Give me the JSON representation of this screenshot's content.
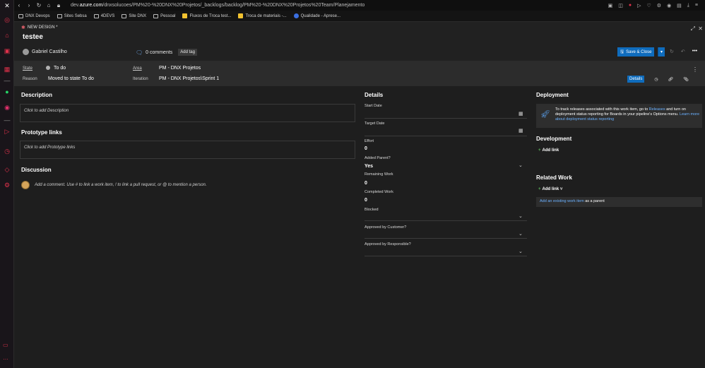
{
  "browser": {
    "url_prefix": "dev.",
    "url_domain": "azure.com",
    "url_path": "/dnxsolucoes/PM%20-%20DNX%20Projetos/_backlogs/backlog/PM%20-%20DNX%20Projetos%20Team/Planejamento",
    "bookmarks": [
      {
        "label": "DNX Devops",
        "icon": "folder-icon"
      },
      {
        "label": "Sites Sebsa",
        "icon": "folder-icon"
      },
      {
        "label": "4DEVS",
        "icon": "folder-icon"
      },
      {
        "label": "Site DNX",
        "icon": "folder-icon"
      },
      {
        "label": "Pessoal",
        "icon": "folder-icon"
      },
      {
        "label": "Fluxos de Troca test...",
        "icon": "bookmark-icon"
      },
      {
        "label": "Troca de materiais -...",
        "icon": "bookmark-icon"
      },
      {
        "label": "Qualidade - Aprese...",
        "icon": "bookmark-icon"
      }
    ]
  },
  "workitem": {
    "type_label": "NEW DESIGN *",
    "title": "testee",
    "assigned_to": "Gabriel Castilho",
    "comments": "0 comments",
    "add_tag": "Add tag",
    "save_label": "Save & Close"
  },
  "statebar": {
    "state_label": "State",
    "state_value": "To do",
    "reason_label": "Reason",
    "reason_value": "Moved to state To do",
    "area_label": "Area",
    "area_value": "PM - DNX Projetos",
    "iteration_label": "Iteration",
    "iteration_value": "PM - DNX Projetos\\Sprint 1",
    "details_tab": "Details"
  },
  "left": {
    "description_title": "Description",
    "description_placeholder": "Click to add Description",
    "prototype_title": "Prototype links",
    "prototype_placeholder": "Click to add Prototype links",
    "discussion_title": "Discussion",
    "discussion_placeholder": "Add a comment. Use # to link a work item, ! to link a pull request, or @ to mention a person."
  },
  "details": {
    "title": "Details",
    "start_date": "Start Date",
    "target_date": "Target Date",
    "effort_label": "Effort",
    "effort_value": "0",
    "added_parent_label": "Added Parent?",
    "added_parent_value": "Yes",
    "remaining_label": "Remaining Work",
    "remaining_value": "0",
    "completed_label": "Completed Work",
    "completed_value": "0",
    "blocked_label": "Blocked",
    "approved_customer_label": "Approved by Customer?",
    "approved_responsible_label": "Approved by Responsible?"
  },
  "deployment": {
    "title": "Deployment",
    "text_1": "To track releases associated with this work item, go to ",
    "releases_link": "Releases",
    "text_2": " and turn on deployment status reporting for Boards in your pipeline's Options menu. ",
    "learn_more": "Learn more about deployment status reporting",
    "development_title": "Development",
    "dev_add_link": "Add link",
    "related_title": "Related Work",
    "related_add_link": "Add link",
    "parent_link": "Add an existing work item",
    "parent_suffix": " as a parent"
  },
  "colors": {
    "accent": "#0f6cbd",
    "link": "#6bb1ff",
    "rail_red": "#e0314b"
  }
}
